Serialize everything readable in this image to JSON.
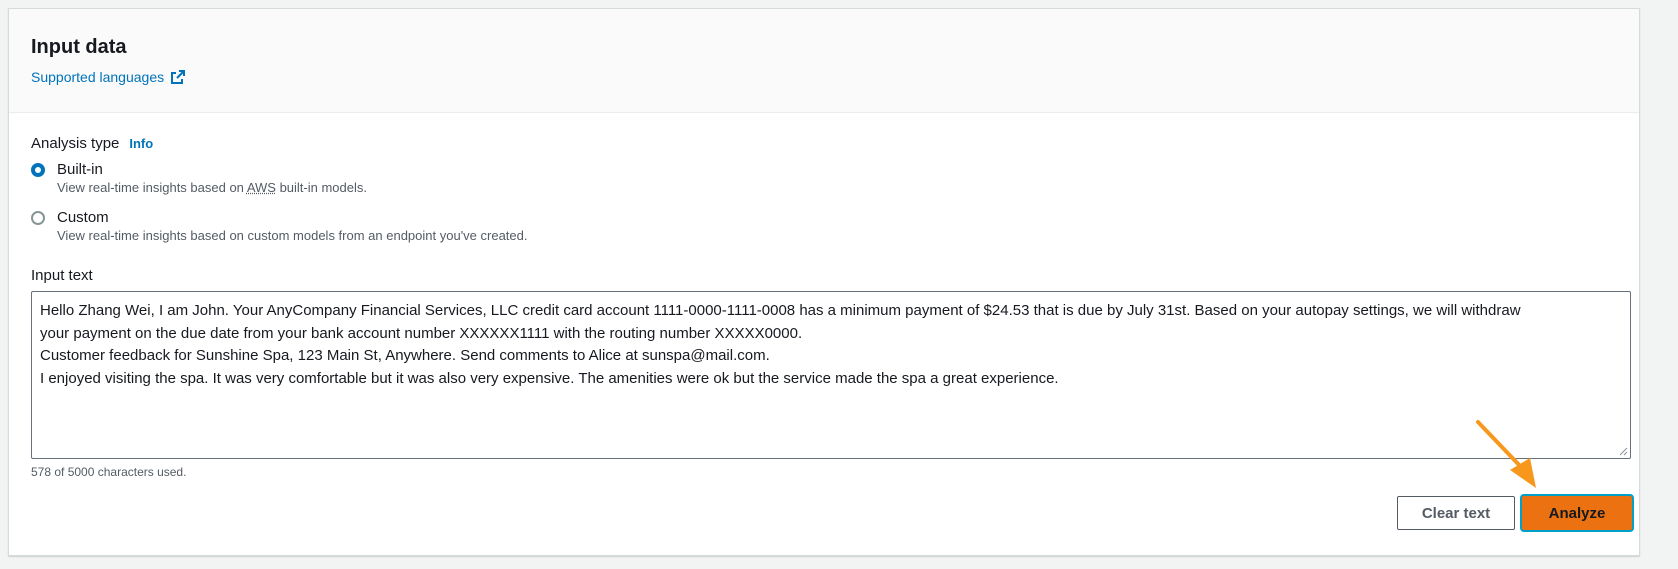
{
  "header": {
    "title": "Input data",
    "supported_languages_link": "Supported languages",
    "external_link_icon": "external-link-icon"
  },
  "analysis_type": {
    "label": "Analysis type",
    "info_link": "Info",
    "options": [
      {
        "label": "Built-in",
        "description_before": "View real-time insights based on ",
        "description_abbr": "AWS",
        "description_after": " built-in models.",
        "selected": true
      },
      {
        "label": "Custom",
        "description": "View real-time insights based on custom models from an endpoint you've created.",
        "selected": false
      }
    ]
  },
  "input_text": {
    "label": "Input text",
    "lines": [
      "Hello Zhang Wei, I am John. Your AnyCompany Financial Services, LLC credit card account 1111-0000-1111-0008 has a minimum payment of $24.53 that is due by July 31st. Based on your autopay settings, we will withdraw",
      "your payment on the due date from your bank account number XXXXXX1111 with the routing number XXXXX0000.",
      "Customer feedback for Sunshine Spa, 123 Main St, Anywhere. Send comments to Alice at sunspa@mail.com.",
      "I enjoyed visiting the spa. It was very comfortable but it was also very expensive. The amenities were ok but the service made the spa a great experience."
    ],
    "char_count": "578 of 5000 characters used."
  },
  "buttons": {
    "clear_label": "Clear text",
    "analyze_label": "Analyze"
  },
  "colors": {
    "link": "#0073bb",
    "primary_button": "#ec7211",
    "annotation_arrow": "#f7981d"
  }
}
